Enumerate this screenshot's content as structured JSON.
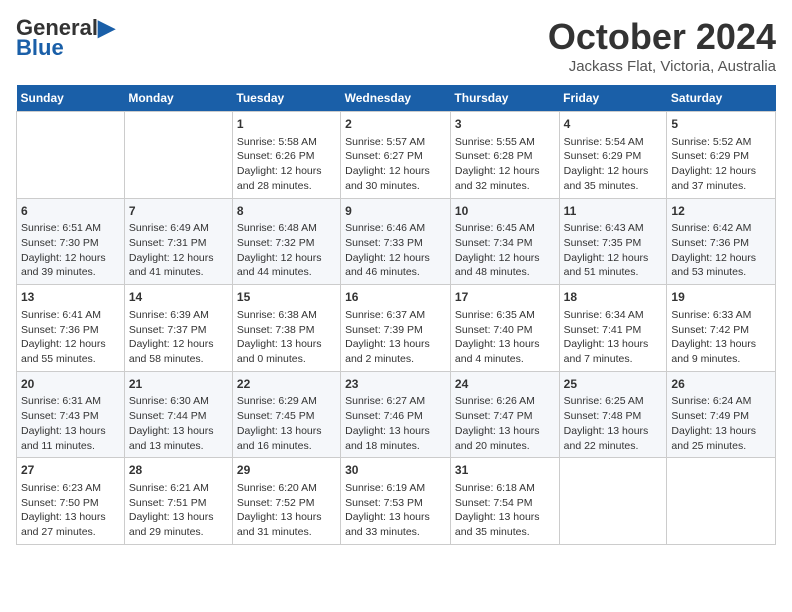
{
  "header": {
    "logo_general": "General",
    "logo_blue": "Blue",
    "month": "October 2024",
    "location": "Jackass Flat, Victoria, Australia"
  },
  "days_of_week": [
    "Sunday",
    "Monday",
    "Tuesday",
    "Wednesday",
    "Thursday",
    "Friday",
    "Saturday"
  ],
  "weeks": [
    [
      {
        "day": "",
        "info": ""
      },
      {
        "day": "",
        "info": ""
      },
      {
        "day": "1",
        "info": "Sunrise: 5:58 AM\nSunset: 6:26 PM\nDaylight: 12 hours\nand 28 minutes."
      },
      {
        "day": "2",
        "info": "Sunrise: 5:57 AM\nSunset: 6:27 PM\nDaylight: 12 hours\nand 30 minutes."
      },
      {
        "day": "3",
        "info": "Sunrise: 5:55 AM\nSunset: 6:28 PM\nDaylight: 12 hours\nand 32 minutes."
      },
      {
        "day": "4",
        "info": "Sunrise: 5:54 AM\nSunset: 6:29 PM\nDaylight: 12 hours\nand 35 minutes."
      },
      {
        "day": "5",
        "info": "Sunrise: 5:52 AM\nSunset: 6:29 PM\nDaylight: 12 hours\nand 37 minutes."
      }
    ],
    [
      {
        "day": "6",
        "info": "Sunrise: 6:51 AM\nSunset: 7:30 PM\nDaylight: 12 hours\nand 39 minutes."
      },
      {
        "day": "7",
        "info": "Sunrise: 6:49 AM\nSunset: 7:31 PM\nDaylight: 12 hours\nand 41 minutes."
      },
      {
        "day": "8",
        "info": "Sunrise: 6:48 AM\nSunset: 7:32 PM\nDaylight: 12 hours\nand 44 minutes."
      },
      {
        "day": "9",
        "info": "Sunrise: 6:46 AM\nSunset: 7:33 PM\nDaylight: 12 hours\nand 46 minutes."
      },
      {
        "day": "10",
        "info": "Sunrise: 6:45 AM\nSunset: 7:34 PM\nDaylight: 12 hours\nand 48 minutes."
      },
      {
        "day": "11",
        "info": "Sunrise: 6:43 AM\nSunset: 7:35 PM\nDaylight: 12 hours\nand 51 minutes."
      },
      {
        "day": "12",
        "info": "Sunrise: 6:42 AM\nSunset: 7:36 PM\nDaylight: 12 hours\nand 53 minutes."
      }
    ],
    [
      {
        "day": "13",
        "info": "Sunrise: 6:41 AM\nSunset: 7:36 PM\nDaylight: 12 hours\nand 55 minutes."
      },
      {
        "day": "14",
        "info": "Sunrise: 6:39 AM\nSunset: 7:37 PM\nDaylight: 12 hours\nand 58 minutes."
      },
      {
        "day": "15",
        "info": "Sunrise: 6:38 AM\nSunset: 7:38 PM\nDaylight: 13 hours\nand 0 minutes."
      },
      {
        "day": "16",
        "info": "Sunrise: 6:37 AM\nSunset: 7:39 PM\nDaylight: 13 hours\nand 2 minutes."
      },
      {
        "day": "17",
        "info": "Sunrise: 6:35 AM\nSunset: 7:40 PM\nDaylight: 13 hours\nand 4 minutes."
      },
      {
        "day": "18",
        "info": "Sunrise: 6:34 AM\nSunset: 7:41 PM\nDaylight: 13 hours\nand 7 minutes."
      },
      {
        "day": "19",
        "info": "Sunrise: 6:33 AM\nSunset: 7:42 PM\nDaylight: 13 hours\nand 9 minutes."
      }
    ],
    [
      {
        "day": "20",
        "info": "Sunrise: 6:31 AM\nSunset: 7:43 PM\nDaylight: 13 hours\nand 11 minutes."
      },
      {
        "day": "21",
        "info": "Sunrise: 6:30 AM\nSunset: 7:44 PM\nDaylight: 13 hours\nand 13 minutes."
      },
      {
        "day": "22",
        "info": "Sunrise: 6:29 AM\nSunset: 7:45 PM\nDaylight: 13 hours\nand 16 minutes."
      },
      {
        "day": "23",
        "info": "Sunrise: 6:27 AM\nSunset: 7:46 PM\nDaylight: 13 hours\nand 18 minutes."
      },
      {
        "day": "24",
        "info": "Sunrise: 6:26 AM\nSunset: 7:47 PM\nDaylight: 13 hours\nand 20 minutes."
      },
      {
        "day": "25",
        "info": "Sunrise: 6:25 AM\nSunset: 7:48 PM\nDaylight: 13 hours\nand 22 minutes."
      },
      {
        "day": "26",
        "info": "Sunrise: 6:24 AM\nSunset: 7:49 PM\nDaylight: 13 hours\nand 25 minutes."
      }
    ],
    [
      {
        "day": "27",
        "info": "Sunrise: 6:23 AM\nSunset: 7:50 PM\nDaylight: 13 hours\nand 27 minutes."
      },
      {
        "day": "28",
        "info": "Sunrise: 6:21 AM\nSunset: 7:51 PM\nDaylight: 13 hours\nand 29 minutes."
      },
      {
        "day": "29",
        "info": "Sunrise: 6:20 AM\nSunset: 7:52 PM\nDaylight: 13 hours\nand 31 minutes."
      },
      {
        "day": "30",
        "info": "Sunrise: 6:19 AM\nSunset: 7:53 PM\nDaylight: 13 hours\nand 33 minutes."
      },
      {
        "day": "31",
        "info": "Sunrise: 6:18 AM\nSunset: 7:54 PM\nDaylight: 13 hours\nand 35 minutes."
      },
      {
        "day": "",
        "info": ""
      },
      {
        "day": "",
        "info": ""
      }
    ]
  ]
}
